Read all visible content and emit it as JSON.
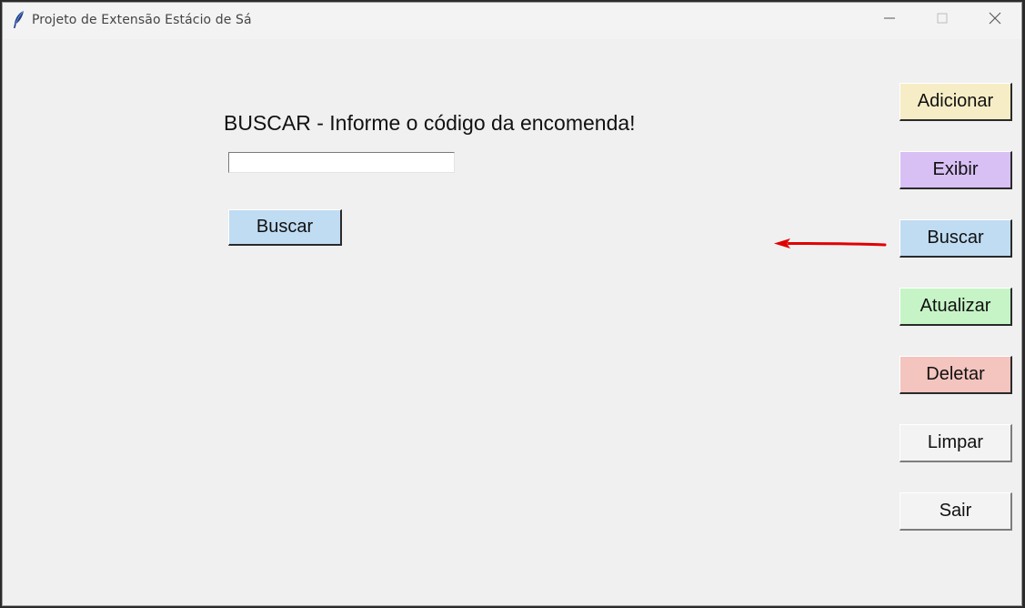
{
  "window": {
    "title": "Projeto de Extensão Estácio de Sá",
    "icon": "feather-icon",
    "controls": [
      "minimize-icon",
      "maximize-icon",
      "close-icon"
    ]
  },
  "form": {
    "heading": "BUSCAR - Informe o código da encomenda!",
    "code_value": "",
    "search_button": {
      "label": "Buscar",
      "color": "#c0dcf3"
    }
  },
  "sidebar": {
    "buttons": [
      {
        "label": "Adicionar",
        "color": "#f6edc6"
      },
      {
        "label": "Exibir",
        "color": "#d8c0f4"
      },
      {
        "label": "Buscar",
        "color": "#c0dcf3"
      },
      {
        "label": "Atualizar",
        "color": "#c6f4c6"
      },
      {
        "label": "Deletar",
        "color": "#f4c4bf"
      },
      {
        "label": "Limpar",
        "color": "#f3f3f3"
      },
      {
        "label": "Sair",
        "color": "#f3f3f3"
      }
    ]
  },
  "annotation": {
    "arrow_color": "#e00000",
    "arrow_direction": "left",
    "points_to": "Buscar"
  }
}
